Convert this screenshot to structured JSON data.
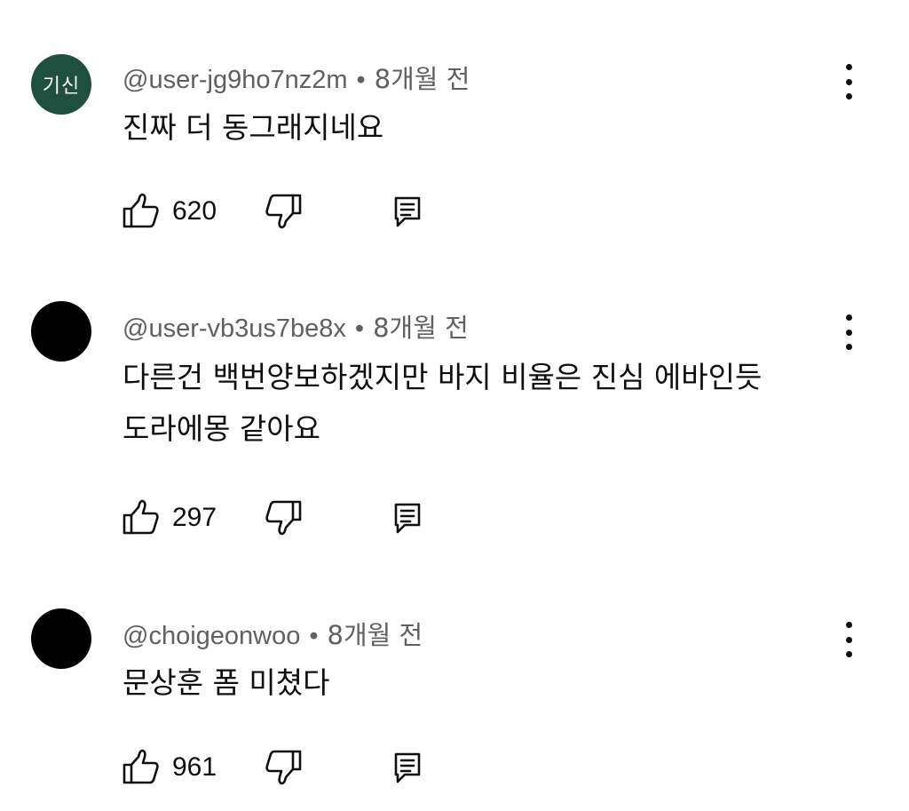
{
  "comments": [
    {
      "avatar_text": "기신",
      "avatar_color": "#1f4f3e",
      "username": "@user-jg9ho7nz2m",
      "separator": "•",
      "time": "8개월 전",
      "lines": [
        "진짜 더 동그래지네요"
      ],
      "likes": "620"
    },
    {
      "avatar_text": "",
      "avatar_color": "#000000",
      "username": "@user-vb3us7be8x",
      "separator": "•",
      "time": "8개월 전",
      "lines": [
        "다른건 백번양보하겠지만 바지 비율은 진심 에바인듯",
        "도라에몽 같아요"
      ],
      "likes": "297"
    },
    {
      "avatar_text": "",
      "avatar_color": "#000000",
      "username": "@choigeonwoo",
      "separator": "•",
      "time": "8개월 전",
      "lines": [
        "문상훈 폼 미쳤다"
      ],
      "likes": "961"
    }
  ],
  "icons": {
    "like": "thumbs-up-icon",
    "dislike": "thumbs-down-icon",
    "reply": "reply-icon",
    "more": "more-vert-icon"
  }
}
